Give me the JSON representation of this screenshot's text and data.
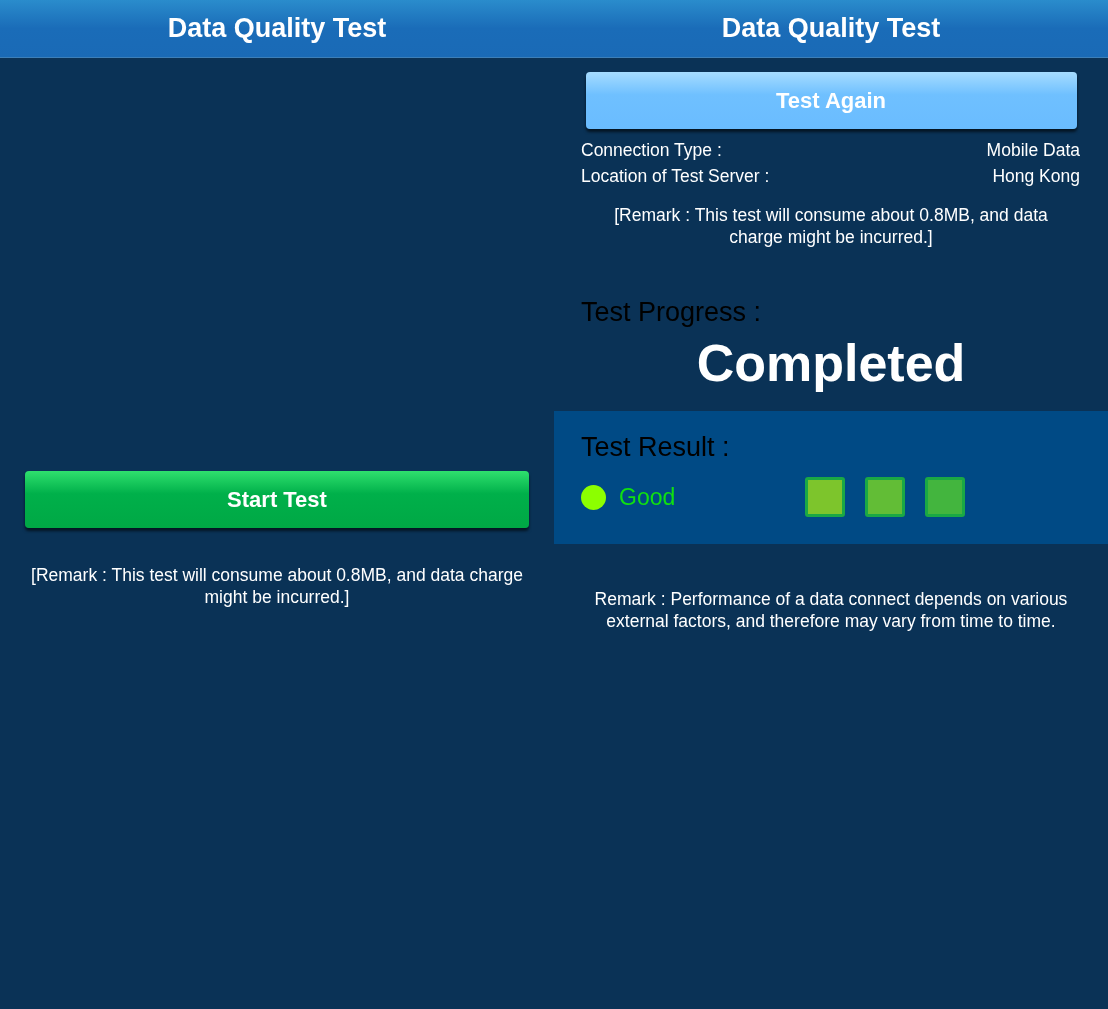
{
  "left_screen": {
    "title": "Data Quality Test",
    "start_button": "Start Test",
    "remark": "[Remark : This test will consume about 0.8MB, and data charge might be incurred.]"
  },
  "right_screen": {
    "title": "Data Quality Test",
    "again_button": "Test Again",
    "info": [
      {
        "label": "Connection Type :",
        "value": "Mobile Data"
      },
      {
        "label": "Location of Test Server :",
        "value": "Hong Kong"
      }
    ],
    "remark": "[Remark : This test will consume about 0.8MB, and data charge might be incurred.]",
    "progress_label": "Test Progress :",
    "progress_status": "Completed",
    "result": {
      "label": "Test Result :",
      "rating": "Good",
      "color": "#8cff00",
      "bars": [
        {
          "color": "#7dc52c"
        },
        {
          "color": "#62bd36"
        },
        {
          "color": "#43b53e"
        }
      ]
    },
    "footer_remark": "Remark : Performance of a data connect depends on various external factors, and therefore may vary from time to time."
  }
}
